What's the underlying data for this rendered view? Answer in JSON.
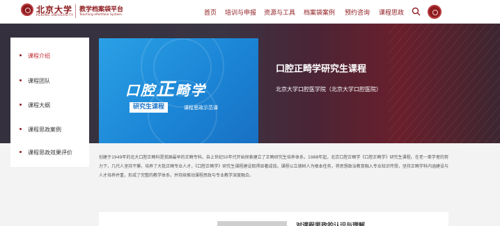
{
  "header": {
    "university_name": "北京大学",
    "university_name_en": "PEKING UNIVERSITY",
    "platform_title": "教学档案袋平台",
    "platform_subtitle": "Teaching ePortfolio System",
    "nav_items": [
      {
        "label": "首页"
      },
      {
        "label": "培训与申报"
      },
      {
        "label": "资源与工具"
      },
      {
        "label": "档案袋案例"
      },
      {
        "label": "预约咨询"
      },
      {
        "label": "课程思政"
      }
    ],
    "search_icon": "search-icon",
    "seal_icon": "university-seal-icon"
  },
  "sidebar": {
    "items": [
      {
        "label": "课程介绍",
        "active": true
      },
      {
        "label": "课程团队",
        "active": false
      },
      {
        "label": "课程大纲",
        "active": false
      },
      {
        "label": "课程思政案例",
        "active": false
      },
      {
        "label": "课程思政效果评价",
        "active": false
      }
    ]
  },
  "banner": {
    "title_part1": "口腔",
    "title_part2": "正",
    "title_part3": "畸学",
    "subtitle_box": "研究生课程",
    "subtitle_text": "课程思政示范课"
  },
  "course": {
    "title": "口腔正畸学研究生课程",
    "department": "北京大学口腔医学院（北京大学口腔医院）"
  },
  "intro_text": "创建于1949年的北大口腔正畸科是我国最早的正畸专科。自上世纪50年代开始探索建立了正畸研究生培养体系，1988年起，北京口腔正畸学《口腔正畸学》研究生课程。在老一辈学者的努力下，几代人坚持不懈，培养了大批正畸专业人才，《口腔正畸学》研究生课程建设取得显著成效。课程以立德树人为根本任务，将思想政治教育融入专业知识传授，坚持正畸学科内涵建设与人才培养并重，形成了完整的教学体系，并持续推动课程思政与专业教学深度融合。",
  "bottom_section": {
    "title": "对课程思政的认识与理解"
  },
  "colors": {
    "brand": "#8e1b1f",
    "active_link": "#c0272d",
    "banner_blue": "#1c86d6"
  }
}
